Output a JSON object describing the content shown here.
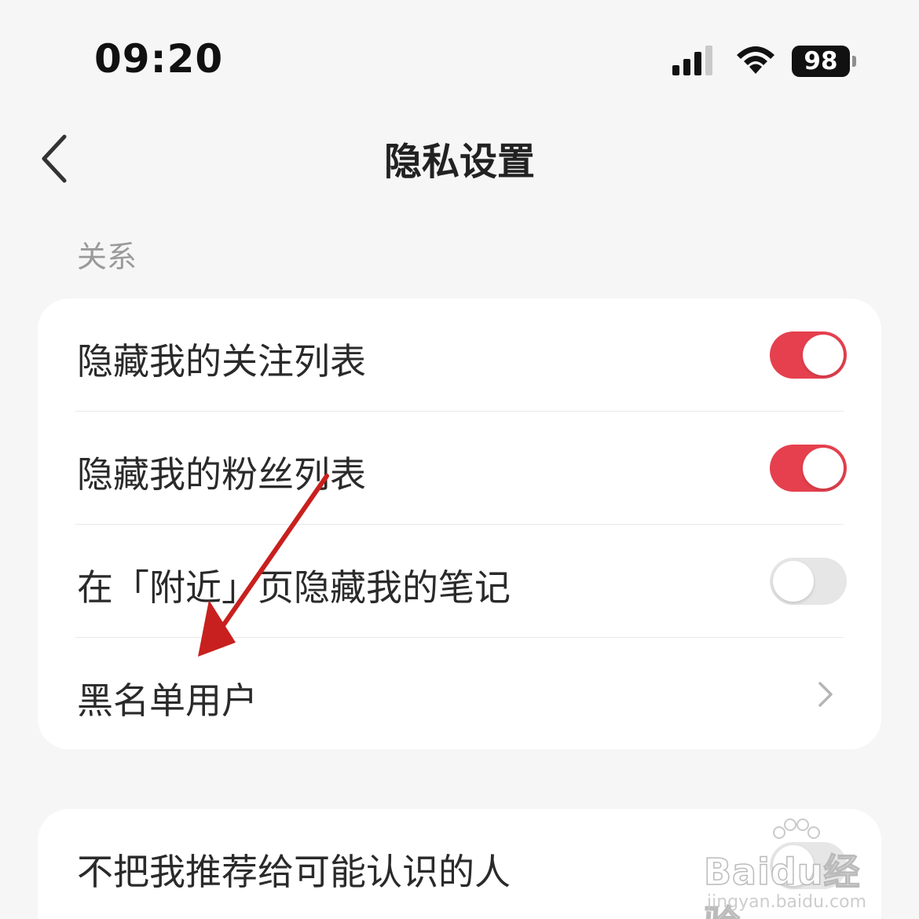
{
  "status_bar": {
    "time": "09:20",
    "battery": "98",
    "icons": [
      "signal-icon",
      "wifi-icon",
      "battery-icon"
    ]
  },
  "nav": {
    "title": "隐私设置",
    "back_icon": "chevron-left-icon"
  },
  "sections": [
    {
      "header": "关系",
      "rows": [
        {
          "label": "隐藏我的关注列表",
          "type": "toggle",
          "on": true
        },
        {
          "label": "隐藏我的粉丝列表",
          "type": "toggle",
          "on": true
        },
        {
          "label": "在「附近」页隐藏我的笔记",
          "type": "toggle",
          "on": false
        },
        {
          "label": "黑名单用户",
          "type": "link",
          "icon": "chevron-right-icon"
        }
      ]
    },
    {
      "rows": [
        {
          "label": "不把我推荐给可能认识的人",
          "type": "toggle",
          "on": false
        }
      ]
    }
  ],
  "colors": {
    "accent": "#e6404e",
    "background": "#f6f6f6",
    "card": "#ffffff",
    "annotation_arrow": "#c8201e"
  },
  "watermark": {
    "brand": "Baidu经验",
    "url": "jingyan.baidu.com"
  }
}
